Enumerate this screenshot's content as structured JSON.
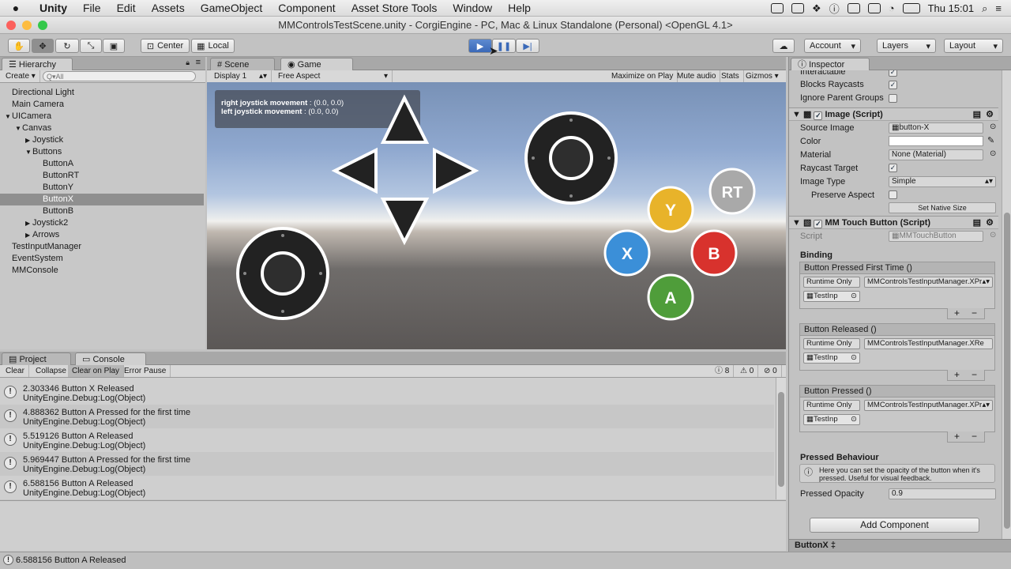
{
  "menubar": {
    "apple": "",
    "items": [
      "Unity",
      "File",
      "Edit",
      "Assets",
      "GameObject",
      "Component",
      "Asset Store Tools",
      "Window",
      "Help"
    ],
    "clock": "Thu 15:01"
  },
  "window": {
    "title": "MMControlsTestScene.unity - CorgiEngine - PC, Mac & Linux Standalone (Personal) <OpenGL 4.1>"
  },
  "toolbar": {
    "pivot": "Center",
    "space": "Local",
    "account": "Account",
    "layers": "Layers",
    "layout": "Layout"
  },
  "hierarchy": {
    "tab": "Hierarchy",
    "create": "Create",
    "search_placeholder": "Q▾All",
    "items": [
      {
        "label": "Directional Light",
        "indent": 0,
        "arrow": ""
      },
      {
        "label": "Main Camera",
        "indent": 0,
        "arrow": ""
      },
      {
        "label": "UICamera",
        "indent": 0,
        "arrow": "▼"
      },
      {
        "label": "Canvas",
        "indent": 1,
        "arrow": "▼"
      },
      {
        "label": "Joystick",
        "indent": 2,
        "arrow": "▶"
      },
      {
        "label": "Buttons",
        "indent": 2,
        "arrow": "▼"
      },
      {
        "label": "ButtonA",
        "indent": 3,
        "arrow": ""
      },
      {
        "label": "ButtonRT",
        "indent": 3,
        "arrow": ""
      },
      {
        "label": "ButtonY",
        "indent": 3,
        "arrow": ""
      },
      {
        "label": "ButtonX",
        "indent": 3,
        "arrow": "",
        "selected": true
      },
      {
        "label": "ButtonB",
        "indent": 3,
        "arrow": ""
      },
      {
        "label": "Joystick2",
        "indent": 2,
        "arrow": "▶"
      },
      {
        "label": "Arrows",
        "indent": 2,
        "arrow": "▶"
      },
      {
        "label": "TestInputManager",
        "indent": 0,
        "arrow": ""
      },
      {
        "label": "EventSystem",
        "indent": 0,
        "arrow": ""
      },
      {
        "label": "MMConsole",
        "indent": 0,
        "arrow": ""
      }
    ]
  },
  "game": {
    "scene_tab": "Scene",
    "game_tab": "Game",
    "display": "Display 1",
    "aspect": "Free Aspect",
    "maximize": "Maximize on Play",
    "mute": "Mute audio",
    "stats": "Stats",
    "gizmos": "Gizmos",
    "overlay": {
      "right_label": "right joystick movement",
      "right_value": " : (0.0, 0.0)",
      "left_label": "left joystick movement",
      "left_value": " : (0.0, 0.0)"
    },
    "buttons": {
      "y": "Y",
      "x": "X",
      "b": "B",
      "a": "A",
      "rt": "RT"
    }
  },
  "console": {
    "project_tab": "Project",
    "console_tab": "Console",
    "clear": "Clear",
    "collapse": "Collapse",
    "clear_on_play": "Clear on Play",
    "error_pause": "Error Pause",
    "count_warn": "8",
    "count_err": "0",
    "count_info": "0",
    "entries": [
      {
        "line1": "2.303346 Button X Released",
        "line2": "UnityEngine.Debug:Log(Object)"
      },
      {
        "line1": "4.888362 Button A Pressed for the first time",
        "line2": "UnityEngine.Debug:Log(Object)"
      },
      {
        "line1": "5.519126 Button A Released",
        "line2": "UnityEngine.Debug:Log(Object)"
      },
      {
        "line1": "5.969447 Button A Pressed for the first time",
        "line2": "UnityEngine.Debug:Log(Object)"
      },
      {
        "line1": "6.588156 Button A Released",
        "line2": "UnityEngine.Debug:Log(Object)"
      }
    ]
  },
  "inspector": {
    "tab": "Inspector",
    "interactable": "Interactable",
    "blocks_raycasts": "Blocks Raycasts",
    "ignore_parent_groups": "Ignore Parent Groups",
    "image_header": "Image (Script)",
    "source_image_label": "Source Image",
    "source_image_value": "button-X",
    "color_label": "Color",
    "material_label": "Material",
    "material_value": "None (Material)",
    "raycast_target_label": "Raycast Target",
    "image_type_label": "Image Type",
    "image_type_value": "Simple",
    "preserve_aspect_label": "Preserve Aspect",
    "set_native_size": "Set Native Size",
    "mmtouch_header": "MM Touch Button (Script)",
    "script_label": "Script",
    "script_value": "MMTouchButton",
    "binding_label": "Binding",
    "events": [
      {
        "title": "Button Pressed First Time ()",
        "runtime": "Runtime Only",
        "method": "MMControlsTestInputManager.XPr",
        "object": "TestInp"
      },
      {
        "title": "Button Released ()",
        "runtime": "Runtime Only",
        "method": "MMControlsTestInputManager.XRe",
        "object": "TestInp"
      },
      {
        "title": "Button Pressed ()",
        "runtime": "Runtime Only",
        "method": "MMControlsTestInputManager.XPr",
        "object": "TestInp"
      }
    ],
    "plus": "+",
    "minus": "−",
    "pressed_behaviour": "Pressed Behaviour",
    "help_text": "Here you can set the opacity of the button when it's pressed. Useful for visual feedback.",
    "pressed_opacity_label": "Pressed Opacity",
    "pressed_opacity_value": "0.9",
    "add_component": "Add Component",
    "footer": "ButtonX ‡"
  },
  "statusbar": {
    "message": "6.588156 Button A Released"
  },
  "colors": {
    "y": "#e8b32a",
    "x": "#3b8fd8",
    "b": "#d8322d",
    "a": "#4f9d3a",
    "rt": "#a9a9a9",
    "selection": "#8f8f8f",
    "play_active": "#3a69b8"
  }
}
